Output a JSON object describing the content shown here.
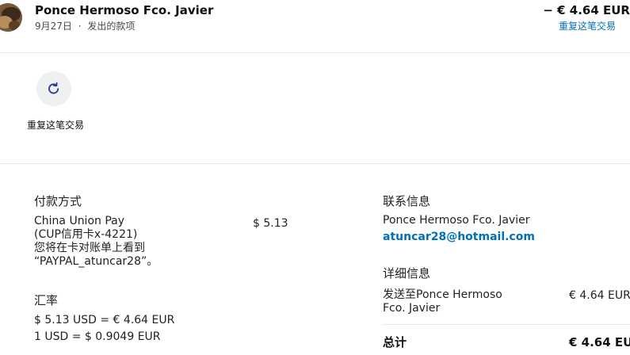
{
  "header": {
    "merchant": "Ponce Hermoso Fco. Javier",
    "date": "9月27日",
    "separator": "·",
    "type": "发出的款项",
    "amount": "− € 4.64 EUR",
    "repeat_link": "重复这笔交易"
  },
  "action": {
    "repeat_label": "重复这笔交易",
    "icon": "refresh-icon"
  },
  "payment": {
    "title": "付款方式",
    "method_line1": "China Union Pay",
    "method_line2": "(CUP信用卡x-4221)",
    "method_line3": "您将在卡对账单上看到",
    "method_line4": "“PAYPAL_atuncar28”。",
    "method_amount": "$ 5.13"
  },
  "exchange": {
    "title": "汇率",
    "line1": "$ 5.13 USD = € 4.64 EUR",
    "line2": "1 USD = $ 0.9049 EUR"
  },
  "contact": {
    "title": "联系信息",
    "name": "Ponce Hermoso Fco. Javier",
    "email": "atuncar28@hotmail.com"
  },
  "details": {
    "title": "详细信息",
    "sent_to_line1": "发送至Ponce Hermoso",
    "sent_to_line2": "Fco. Javier",
    "sent_amount": "€ 4.64 EUR",
    "total_label": "总计",
    "total_amount": "€ 4.64 EUR"
  },
  "colors": {
    "link": "#0070ba",
    "icon_bg": "#eef0f2"
  }
}
